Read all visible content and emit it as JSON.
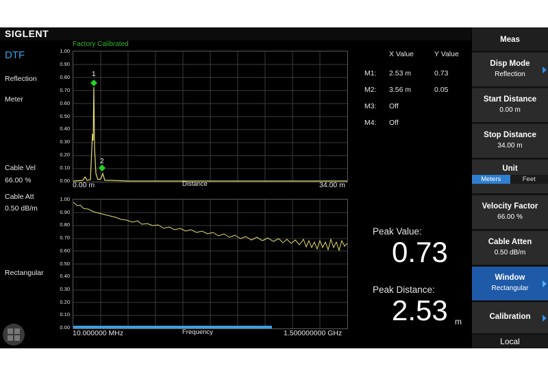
{
  "header": {
    "brand": "SIGLENT",
    "calibration_status": "Factory Calibrated"
  },
  "left_panel": {
    "mode": "DTF",
    "measure_type": "Reflection",
    "unit": "Meter",
    "cable_vel_label": "Cable Vel",
    "cable_vel_value": "66.00 %",
    "cable_att_label": "Cable Att",
    "cable_att_value": "0.50 dB/m",
    "window": "Rectangular"
  },
  "top_plot": {
    "yticks": [
      "1.00",
      "0.90",
      "0.80",
      "0.70",
      "0.60",
      "0.50",
      "0.40",
      "0.30",
      "0.20",
      "0.10",
      "0.00"
    ],
    "x_start": "0.00 m",
    "x_mid": "Distance",
    "x_end": "34.00 m",
    "marker1": "1",
    "marker2": "2"
  },
  "bottom_plot": {
    "yticks": [
      "1.00",
      "0.90",
      "0.80",
      "0.70",
      "0.60",
      "0.50",
      "0.40",
      "0.30",
      "0.20",
      "0.10",
      "0.00"
    ],
    "x_start": "10.000000 MHz",
    "x_mid": "Frequency",
    "x_end": "1.500000000 GHz"
  },
  "markers": {
    "x_header": "X Value",
    "y_header": "Y Value",
    "rows": [
      {
        "name": "M1:",
        "x": "2.53 m",
        "y": "0.73"
      },
      {
        "name": "M2:",
        "x": "3.56 m",
        "y": "0.05"
      },
      {
        "name": "M3:",
        "x": "Off",
        "y": ""
      },
      {
        "name": "M4:",
        "x": "Off",
        "y": ""
      }
    ]
  },
  "peak": {
    "value_label": "Peak Value:",
    "value": "0.73",
    "distance_label": "Peak Distance:",
    "distance": "2.53",
    "distance_unit": "m"
  },
  "softkeys": {
    "title": "Meas",
    "disp_mode": {
      "title": "Disp Mode",
      "value": "Reflection"
    },
    "start_distance": {
      "title": "Start Distance",
      "value": "0.00 m"
    },
    "stop_distance": {
      "title": "Stop Distance",
      "value": "34.00 m"
    },
    "unit": {
      "title": "Unit",
      "opt1": "Meters",
      "opt2": "Feet"
    },
    "velocity_factor": {
      "title": "Velocity Factor",
      "value": "66.00 %"
    },
    "cable_atten": {
      "title": "Cable Atten",
      "value": "0.50 dB/m"
    },
    "window": {
      "title": "Window",
      "value": "Rectangular"
    },
    "calibration": {
      "title": "Calibration"
    },
    "local": "Local"
  },
  "colors": {
    "trace": "#e8e070",
    "marker": "#22d322",
    "accent": "#1f5aa8",
    "mode": "#37a3e6"
  }
}
